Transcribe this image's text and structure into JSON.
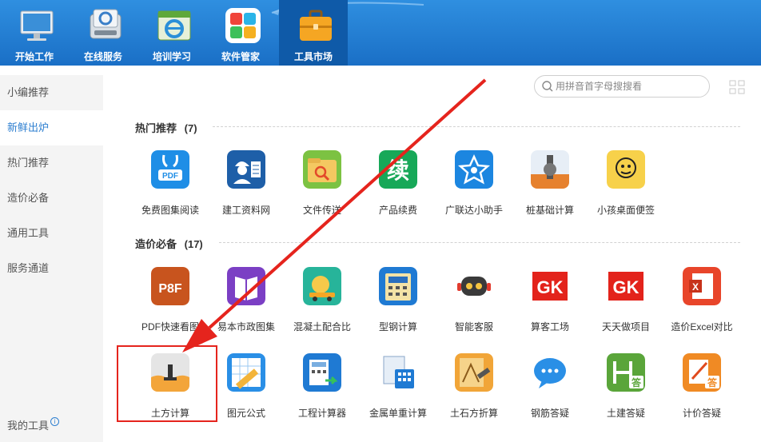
{
  "topnav": [
    {
      "label": "开始工作",
      "icon": "monitor-icon"
    },
    {
      "label": "在线服务",
      "icon": "online-service-icon"
    },
    {
      "label": "培训学习",
      "icon": "ie-browser-icon"
    },
    {
      "label": "软件管家",
      "icon": "software-manager-icon"
    },
    {
      "label": "工具市场",
      "icon": "toolbox-icon"
    }
  ],
  "sidebar": {
    "items": [
      "小编推荐",
      "新鲜出炉",
      "热门推荐",
      "造价必备",
      "通用工具",
      "服务通道"
    ],
    "active": "新鲜出炉",
    "my_tools": "我的工具",
    "info_glyph": "i"
  },
  "search": {
    "placeholder": "用拼音首字母搜搜看",
    "value": ""
  },
  "sections": [
    {
      "title": "热门推荐",
      "count": "(7)"
    },
    {
      "title": "造价必备",
      "count": "(17)"
    }
  ],
  "tools": [
    {
      "label": "免费图集阅读",
      "icon": "pdf-rabbit-icon"
    },
    {
      "label": "建工资料网",
      "icon": "construction-worker-icon"
    },
    {
      "label": "文件传送",
      "icon": "file-folder-icon"
    },
    {
      "label": "产品续费",
      "icon": "renew-icon"
    },
    {
      "label": "广联达小助手",
      "icon": "assistant-star-icon"
    },
    {
      "label": "桩基础计算",
      "icon": "pile-foundation-icon"
    },
    {
      "label": "小孩桌面便签",
      "icon": "sticky-note-icon"
    },
    {
      "label": "PDF快速看图",
      "icon": "pdf-viewer-icon"
    },
    {
      "label": "易本市政图集",
      "icon": "municipal-atlas-icon"
    },
    {
      "label": "混凝土配合比",
      "icon": "concrete-mixer-icon"
    },
    {
      "label": "型钢计算",
      "icon": "steel-section-icon"
    },
    {
      "label": "智能客服",
      "icon": "robot-icon"
    },
    {
      "label": "算客工场",
      "icon": "gk-logo-icon"
    },
    {
      "label": "天天做项目",
      "icon": "gk-logo-icon"
    },
    {
      "label": "造价Excel对比",
      "icon": "excel-compare-icon"
    },
    {
      "label": "土方计算",
      "icon": "earthwork-icon"
    },
    {
      "label": "图元公式",
      "icon": "formula-ruler-icon"
    },
    {
      "label": "工程计算器",
      "icon": "calculator-icon"
    },
    {
      "label": "金属单重计算",
      "icon": "metal-weight-icon"
    },
    {
      "label": "土石方折算",
      "icon": "earth-rock-icon"
    },
    {
      "label": "钢筋答疑",
      "icon": "chat-bubble-icon"
    },
    {
      "label": "土建答疑",
      "icon": "civil-qa-icon"
    },
    {
      "label": "计价答疑",
      "icon": "pricing-qa-icon"
    }
  ],
  "icon_glyphs": {
    "pdf": "PDF",
    "p8f": "P8F",
    "renew": "续",
    "answer": "答",
    "gk": "GK",
    "excel_x": "X"
  },
  "colors": {
    "topbar": "#1f7ad3",
    "accent": "#2e7fd0",
    "highlight": "#e5241d",
    "arrow": "#e5241d"
  }
}
